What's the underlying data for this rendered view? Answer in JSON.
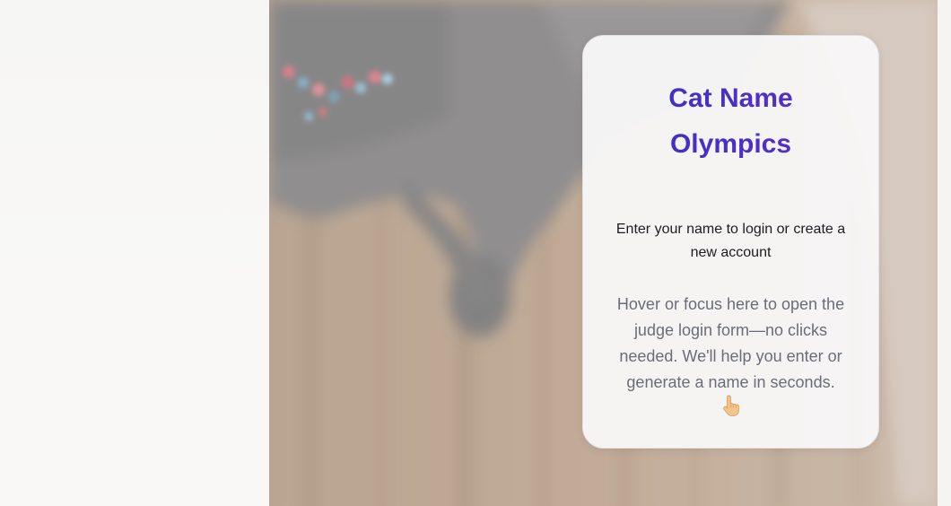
{
  "card": {
    "title_line1": "Cat Name",
    "title_line2": "Olympics",
    "subtitle": "Enter your name to login or create a new account",
    "hint": "Hover or focus here to open the judge login form—no clicks needed. We'll help you enter or generate a name in seconds.",
    "hint_icon": "pointing-hand-icon"
  },
  "colors": {
    "title_gradient_start": "#3b2fc4",
    "title_gradient_end": "#5a2fc8",
    "subtitle": "#1c1c22",
    "hint": "#6a6d78",
    "card_background": "#f8f7f7"
  }
}
